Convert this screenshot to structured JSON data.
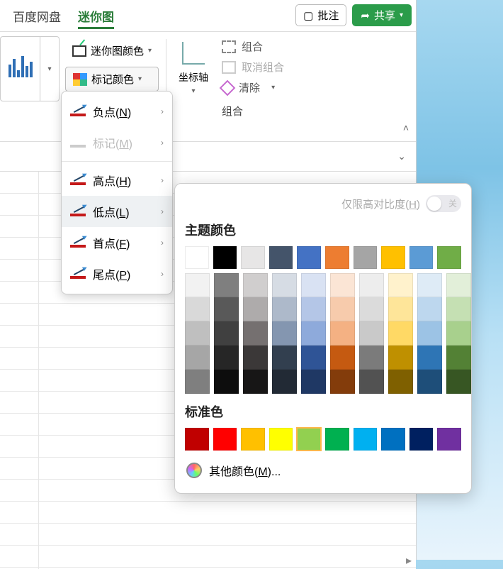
{
  "tabs": {
    "baidu": "百度网盘",
    "sparkline": "迷你图"
  },
  "topbuttons": {
    "annotate": "批注",
    "share": "共享"
  },
  "ribbon": {
    "sparkline_color": "迷你图颜色",
    "marker_color": "标记颜色",
    "axis": "坐标轴",
    "group": "组合",
    "ungroup": "取消组合",
    "clear": "清除",
    "group_footer": "组合"
  },
  "ctx": {
    "negative": {
      "pre": "负点(",
      "key": "N",
      "post": ")"
    },
    "marker": {
      "pre": "标记(",
      "key": "M",
      "post": ")"
    },
    "high": {
      "pre": "高点(",
      "key": "H",
      "post": ")"
    },
    "low": {
      "pre": "低点(",
      "key": "L",
      "post": ")"
    },
    "first": {
      "pre": "首点(",
      "key": "F",
      "post": ")"
    },
    "last": {
      "pre": "尾点(",
      "key": "P",
      "post": ")"
    }
  },
  "picker": {
    "high_contrast_pre": "仅限高对比度(",
    "high_contrast_key": "H",
    "high_contrast_post": ")",
    "toggle_off": "关",
    "theme_title": "主题颜色",
    "std_title": "标准色",
    "more_pre": "其他颜色(",
    "more_key": "M",
    "more_post": ")..."
  },
  "theme_row": [
    "#ffffff",
    "#000000",
    "#e7e6e6",
    "#44546a",
    "#4472c4",
    "#ed7d31",
    "#a5a5a5",
    "#ffc000",
    "#5b9bd5",
    "#70ad47"
  ],
  "theme_shades": [
    [
      "#f2f2f2",
      "#d9d9d9",
      "#bfbfbf",
      "#a6a6a6",
      "#7f7f7f"
    ],
    [
      "#7f7f7f",
      "#595959",
      "#404040",
      "#262626",
      "#0d0d0d"
    ],
    [
      "#d0cece",
      "#aeabab",
      "#757070",
      "#3b3838",
      "#171616"
    ],
    [
      "#d6dce4",
      "#adb9ca",
      "#8496b0",
      "#323f4f",
      "#222a35"
    ],
    [
      "#d9e2f3",
      "#b4c6e7",
      "#8eaadb",
      "#2f5496",
      "#1f3864"
    ],
    [
      "#fbe5d5",
      "#f7cbac",
      "#f4b183",
      "#c55a11",
      "#833c0b"
    ],
    [
      "#ededed",
      "#dbdbdb",
      "#c9c9c9",
      "#7b7b7b",
      "#525252"
    ],
    [
      "#fff2cc",
      "#fee599",
      "#ffd965",
      "#bf9000",
      "#7f6000"
    ],
    [
      "#deebf6",
      "#bdd7ee",
      "#9cc3e5",
      "#2e75b5",
      "#1e4e79"
    ],
    [
      "#e2efd9",
      "#c5e0b3",
      "#a8d08d",
      "#538135",
      "#375623"
    ]
  ],
  "standard_colors": [
    "#c00000",
    "#ff0000",
    "#ffc000",
    "#ffff00",
    "#92d050",
    "#00b050",
    "#00b0f0",
    "#0070c0",
    "#002060",
    "#7030a0"
  ],
  "selected_standard": 4
}
